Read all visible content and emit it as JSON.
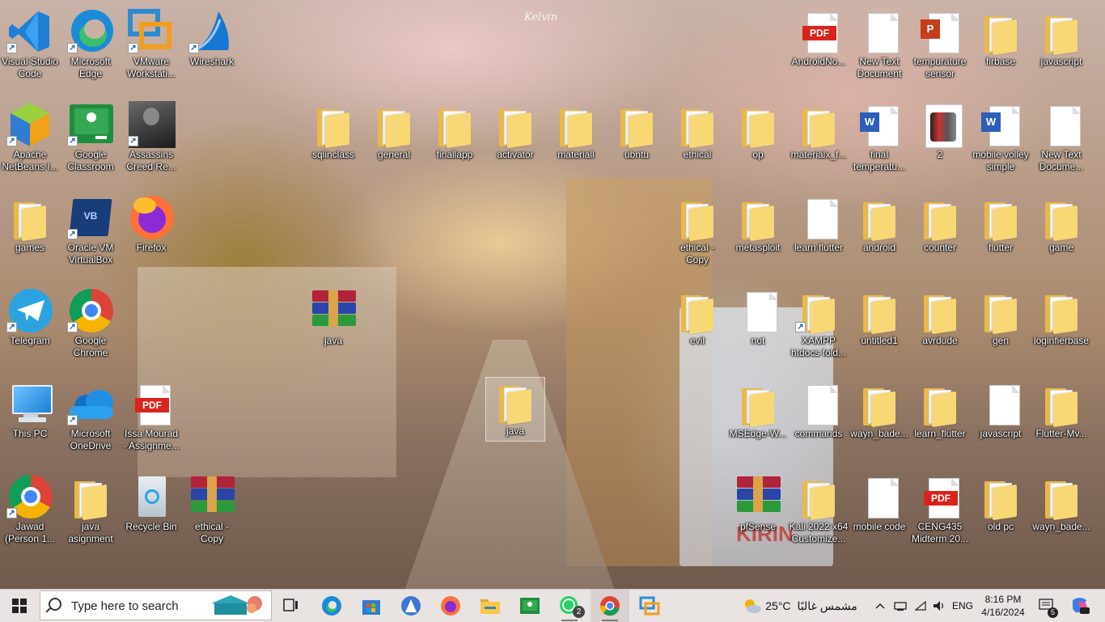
{
  "desktop": {
    "wallpaper_signature": "Kelvin",
    "wallpaper_sign_text": "KIRIN",
    "icons": [
      {
        "label": "Visual Studio\nCode",
        "type": "vscode",
        "shortcut": true
      },
      {
        "label": "Microsoft\nEdge",
        "type": "edge",
        "shortcut": true
      },
      {
        "label": "VMware\nWorkstati...",
        "type": "vmware",
        "shortcut": true
      },
      {
        "label": "Wireshark",
        "type": "wireshark",
        "shortcut": true
      },
      {
        "label": "AndroidNo...",
        "type": "pdf"
      },
      {
        "label": "New Text\nDocument",
        "type": "doc"
      },
      {
        "label": "tempurature\nsensor",
        "type": "pptx"
      },
      {
        "label": "firbase",
        "type": "folder"
      },
      {
        "label": "javascript",
        "type": "folder"
      },
      {
        "label": "Apache\nNetBeans I...",
        "type": "netbeans",
        "shortcut": true
      },
      {
        "label": "Google\nClassroom",
        "type": "classroom",
        "shortcut": true
      },
      {
        "label": "Assassins\nCreed Re...",
        "type": "game",
        "shortcut": true
      },
      {
        "label": "sqlinclass",
        "type": "folder"
      },
      {
        "label": "general",
        "type": "folder"
      },
      {
        "label": "finallapp",
        "type": "folder"
      },
      {
        "label": "activator",
        "type": "folder"
      },
      {
        "label": "materiall",
        "type": "folder"
      },
      {
        "label": "ubntu",
        "type": "folder"
      },
      {
        "label": "ethical",
        "type": "folder"
      },
      {
        "label": "op",
        "type": "folder"
      },
      {
        "label": "materialx_f...",
        "type": "folder"
      },
      {
        "label": "final\ntemperatu...",
        "type": "word"
      },
      {
        "label": "2",
        "type": "phone"
      },
      {
        "label": "mobile volley\nsimple",
        "type": "word"
      },
      {
        "label": "New Text\nDocume...",
        "type": "doc"
      },
      {
        "label": "games",
        "type": "folder"
      },
      {
        "label": "Oracle VM\nVirtualBox",
        "type": "virtualbox",
        "shortcut": true
      },
      {
        "label": "Firefox",
        "type": "firefox"
      },
      {
        "label": "ethical -\nCopy",
        "type": "folder"
      },
      {
        "label": "metasploit",
        "type": "folder"
      },
      {
        "label": "learn flutter",
        "type": "doc"
      },
      {
        "label": "android",
        "type": "folder"
      },
      {
        "label": "counter",
        "type": "folder"
      },
      {
        "label": "flutter",
        "type": "folder"
      },
      {
        "label": "game",
        "type": "folder"
      },
      {
        "label": "Telegram",
        "type": "telegram",
        "shortcut": true
      },
      {
        "label": "Google\nChrome",
        "type": "chrome",
        "shortcut": true
      },
      {
        "label": "java",
        "type": "winrar"
      },
      {
        "label": "evil",
        "type": "folder"
      },
      {
        "label": "not",
        "type": "doc"
      },
      {
        "label": "XAMPP\nhtdocs fold...",
        "type": "folder",
        "shortcut": true
      },
      {
        "label": "untitled1",
        "type": "folder"
      },
      {
        "label": "avrdude",
        "type": "folder"
      },
      {
        "label": "gen",
        "type": "folder"
      },
      {
        "label": "loginfierbase",
        "type": "folder"
      },
      {
        "label": "This PC",
        "type": "thispc"
      },
      {
        "label": "Microsoft\nOneDrive",
        "type": "onedrive",
        "shortcut": true
      },
      {
        "label": "Issa Mourad\n- Assignme...",
        "type": "pdf"
      },
      {
        "label": "java",
        "type": "folder",
        "selected": true
      },
      {
        "label": "MSEdge-W...",
        "type": "folder"
      },
      {
        "label": "commands",
        "type": "doc"
      },
      {
        "label": "wayn_bade...",
        "type": "folder"
      },
      {
        "label": "learn_flutter",
        "type": "folder"
      },
      {
        "label": "javascript",
        "type": "doc"
      },
      {
        "label": "Flutter-Mv...",
        "type": "folder"
      },
      {
        "label": "Jawad\n(Person 1...",
        "type": "chrome",
        "shortcut": true
      },
      {
        "label": "java\nasignment",
        "type": "folder"
      },
      {
        "label": "Recycle Bin",
        "type": "recycle"
      },
      {
        "label": "ethical -\nCopy",
        "type": "winrar"
      },
      {
        "label": "pfSense",
        "type": "winrar"
      },
      {
        "label": "Kali 2022 x64\nCustomize...",
        "type": "folder"
      },
      {
        "label": "mobile code",
        "type": "doc"
      },
      {
        "label": "CENG435\nMidterm 20...",
        "type": "pdf"
      },
      {
        "label": "old pc",
        "type": "folder"
      },
      {
        "label": "wayn_bade...",
        "type": "folder"
      }
    ]
  },
  "taskbar": {
    "search_placeholder": "Type here to search",
    "pinned": [
      {
        "name": "task-view"
      },
      {
        "name": "edge"
      },
      {
        "name": "microsoft-store"
      },
      {
        "name": "android-studio"
      },
      {
        "name": "firefox"
      },
      {
        "name": "file-explorer"
      },
      {
        "name": "google-classroom"
      },
      {
        "name": "whatsapp",
        "badge": "2"
      },
      {
        "name": "chrome"
      },
      {
        "name": "vmware"
      }
    ],
    "weather": {
      "temp": "25°C",
      "condition": "مشمس غالبًا"
    },
    "language": "ENG",
    "time": "8:16 PM",
    "date": "4/16/2024",
    "notifications": "5"
  },
  "colors": {
    "taskbar_bg": "#e9e4e2",
    "folder": "#f8d775",
    "pdf_red": "#d9241e",
    "word_blue": "#2b5fb8"
  }
}
